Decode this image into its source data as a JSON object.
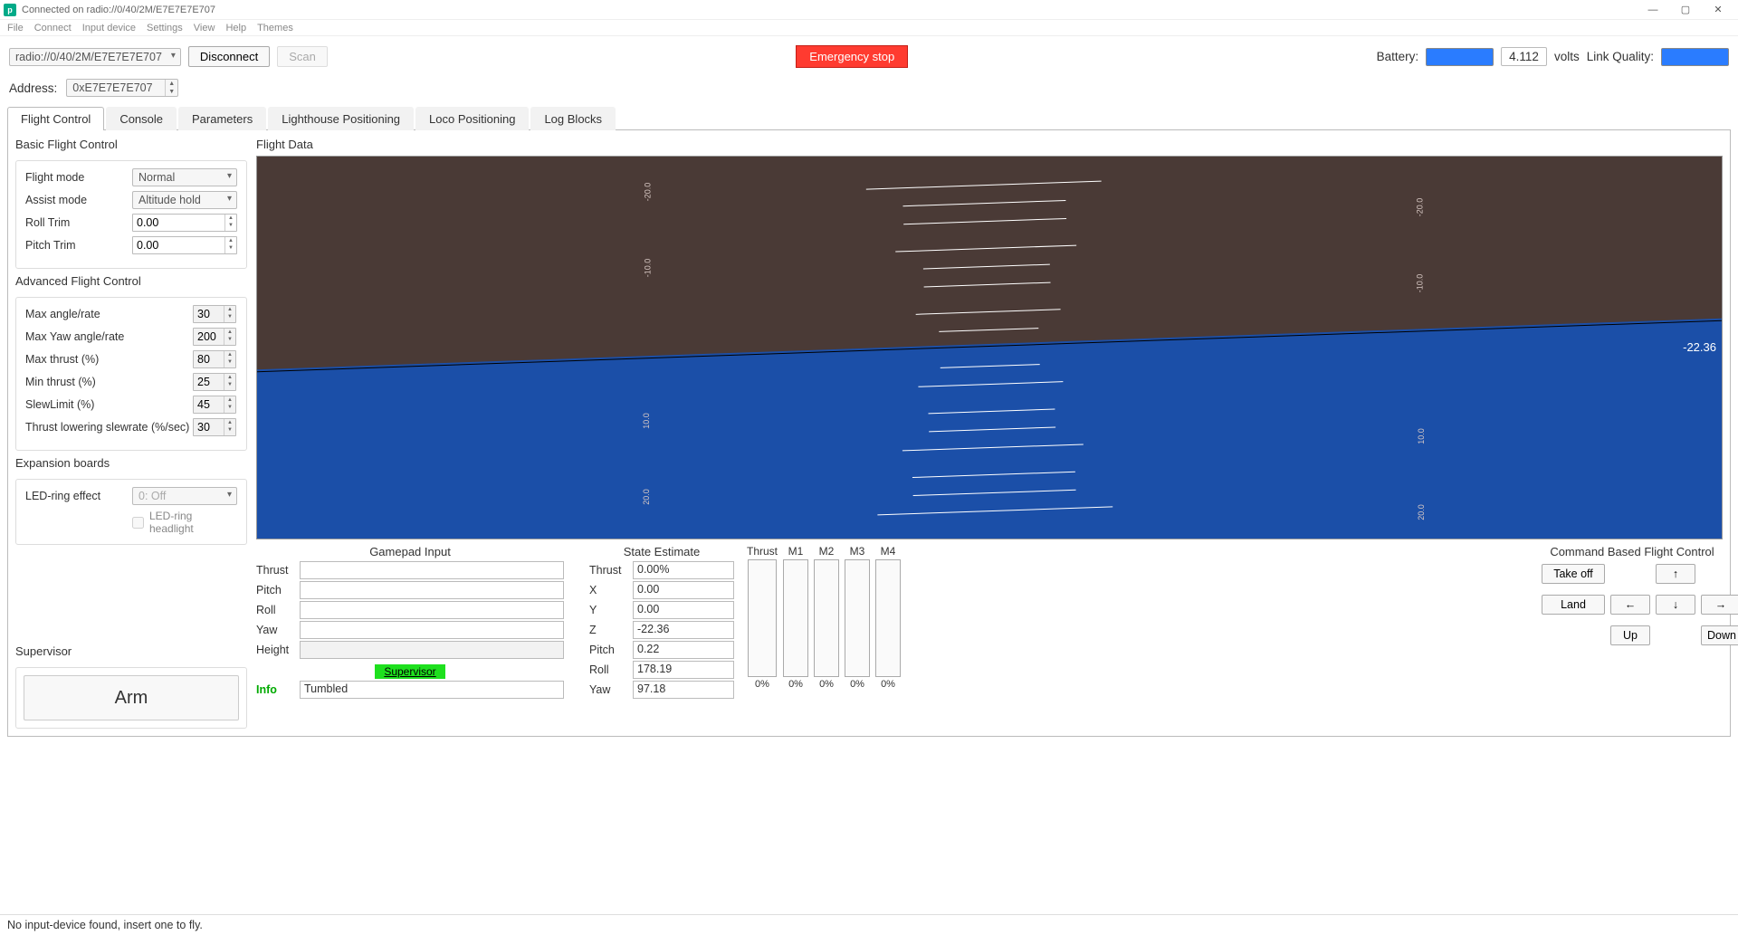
{
  "window": {
    "title": "Connected on radio://0/40/2M/E7E7E7E707",
    "menu": [
      "File",
      "Connect",
      "Input device",
      "Settings",
      "View",
      "Help",
      "Themes"
    ],
    "win_buttons": {
      "min": "—",
      "max": "▢",
      "close": "✕"
    }
  },
  "toolbar": {
    "radio_uri": "radio://0/40/2M/E7E7E7E707",
    "disconnect": "Disconnect",
    "scan": "Scan",
    "emergency": "Emergency stop",
    "battery_label": "Battery:",
    "battery_value": "4.112",
    "volts": "volts",
    "link_quality_label": "Link Quality:"
  },
  "address": {
    "label": "Address:",
    "value": "0xE7E7E7E707"
  },
  "tabs": [
    "Flight Control",
    "Console",
    "Parameters",
    "Lighthouse Positioning",
    "Loco Positioning",
    "Log Blocks"
  ],
  "basic": {
    "title": "Basic Flight Control",
    "flight_mode_label": "Flight mode",
    "flight_mode": "Normal",
    "assist_mode_label": "Assist mode",
    "assist_mode": "Altitude hold",
    "roll_trim_label": "Roll Trim",
    "roll_trim": "0.00",
    "pitch_trim_label": "Pitch Trim",
    "pitch_trim": "0.00"
  },
  "advanced": {
    "title": "Advanced Flight Control",
    "max_angle_label": "Max angle/rate",
    "max_angle": "30",
    "max_yaw_label": "Max Yaw angle/rate",
    "max_yaw": "200",
    "max_thrust_label": "Max thrust (%)",
    "max_thrust": "80",
    "min_thrust_label": "Min thrust (%)",
    "min_thrust": "25",
    "slew_limit_label": "SlewLimit (%)",
    "slew_limit": "45",
    "thrust_lower_label": "Thrust lowering slewrate (%/sec)",
    "thrust_lower": "30"
  },
  "expansion": {
    "title": "Expansion boards",
    "led_label": "LED-ring effect",
    "led_value": "0: Off",
    "headlight_label": "LED-ring headlight"
  },
  "supervisor": {
    "title": "Supervisor",
    "arm": "Arm"
  },
  "flight_data": {
    "title": "Flight Data",
    "alt_readout": "-22.36",
    "ticks_left": [
      "-20.0",
      "-10.0",
      "10.0",
      "20.0"
    ],
    "ticks_right": [
      "-20.0",
      "-10.0",
      "10.0",
      "20.0"
    ]
  },
  "gamepad": {
    "title": "Gamepad Input",
    "rows": [
      "Thrust",
      "Pitch",
      "Roll",
      "Yaw",
      "Height"
    ],
    "supervisor_pill": "Supervisor",
    "info_label": "Info",
    "info_value": "Tumbled"
  },
  "state": {
    "title": "State Estimate",
    "items": [
      {
        "k": "Thrust",
        "v": "0.00%"
      },
      {
        "k": "X",
        "v": "0.00"
      },
      {
        "k": "Y",
        "v": "0.00"
      },
      {
        "k": "Z",
        "v": "-22.36"
      },
      {
        "k": "Pitch",
        "v": "0.22"
      },
      {
        "k": "Roll",
        "v": "178.19"
      },
      {
        "k": "Yaw",
        "v": "97.18"
      }
    ]
  },
  "motors": {
    "thrust_label": "Thrust",
    "thrust_val": "0%",
    "cols": [
      {
        "l": "M1",
        "v": "0%"
      },
      {
        "l": "M2",
        "v": "0%"
      },
      {
        "l": "M3",
        "v": "0%"
      },
      {
        "l": "M4",
        "v": "0%"
      }
    ]
  },
  "command": {
    "title": "Command Based Flight Control",
    "takeoff": "Take off",
    "land": "Land",
    "up": "Up",
    "down": "Down",
    "arrows": {
      "up": "↑",
      "left": "←",
      "right": "→",
      "down": "↓"
    }
  },
  "footer": "No input-device found, insert one to fly."
}
